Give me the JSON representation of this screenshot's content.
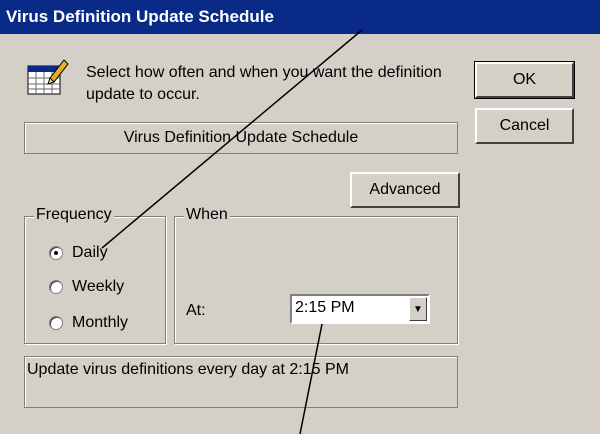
{
  "window": {
    "title": "Virus Definition Update Schedule"
  },
  "header": {
    "instruction": "Select how often and when you want the definition update to occur.",
    "icon": "calendar-pencil-icon"
  },
  "name_field": {
    "value": "Virus Definition Update Schedule"
  },
  "buttons": {
    "ok": "OK",
    "cancel": "Cancel",
    "advanced": "Advanced"
  },
  "frequency": {
    "legend": "Frequency",
    "options": [
      {
        "label": "Daily",
        "checked": true
      },
      {
        "label": "Weekly",
        "checked": false
      },
      {
        "label": "Monthly",
        "checked": false
      }
    ]
  },
  "when": {
    "legend": "When",
    "at_label": "At:",
    "time_value": "2:15 PM"
  },
  "summary": {
    "text": "Update virus definitions every day at 2:15 PM"
  },
  "colors": {
    "titlebar": "#0a2a88",
    "face": "#d4d0c8"
  }
}
